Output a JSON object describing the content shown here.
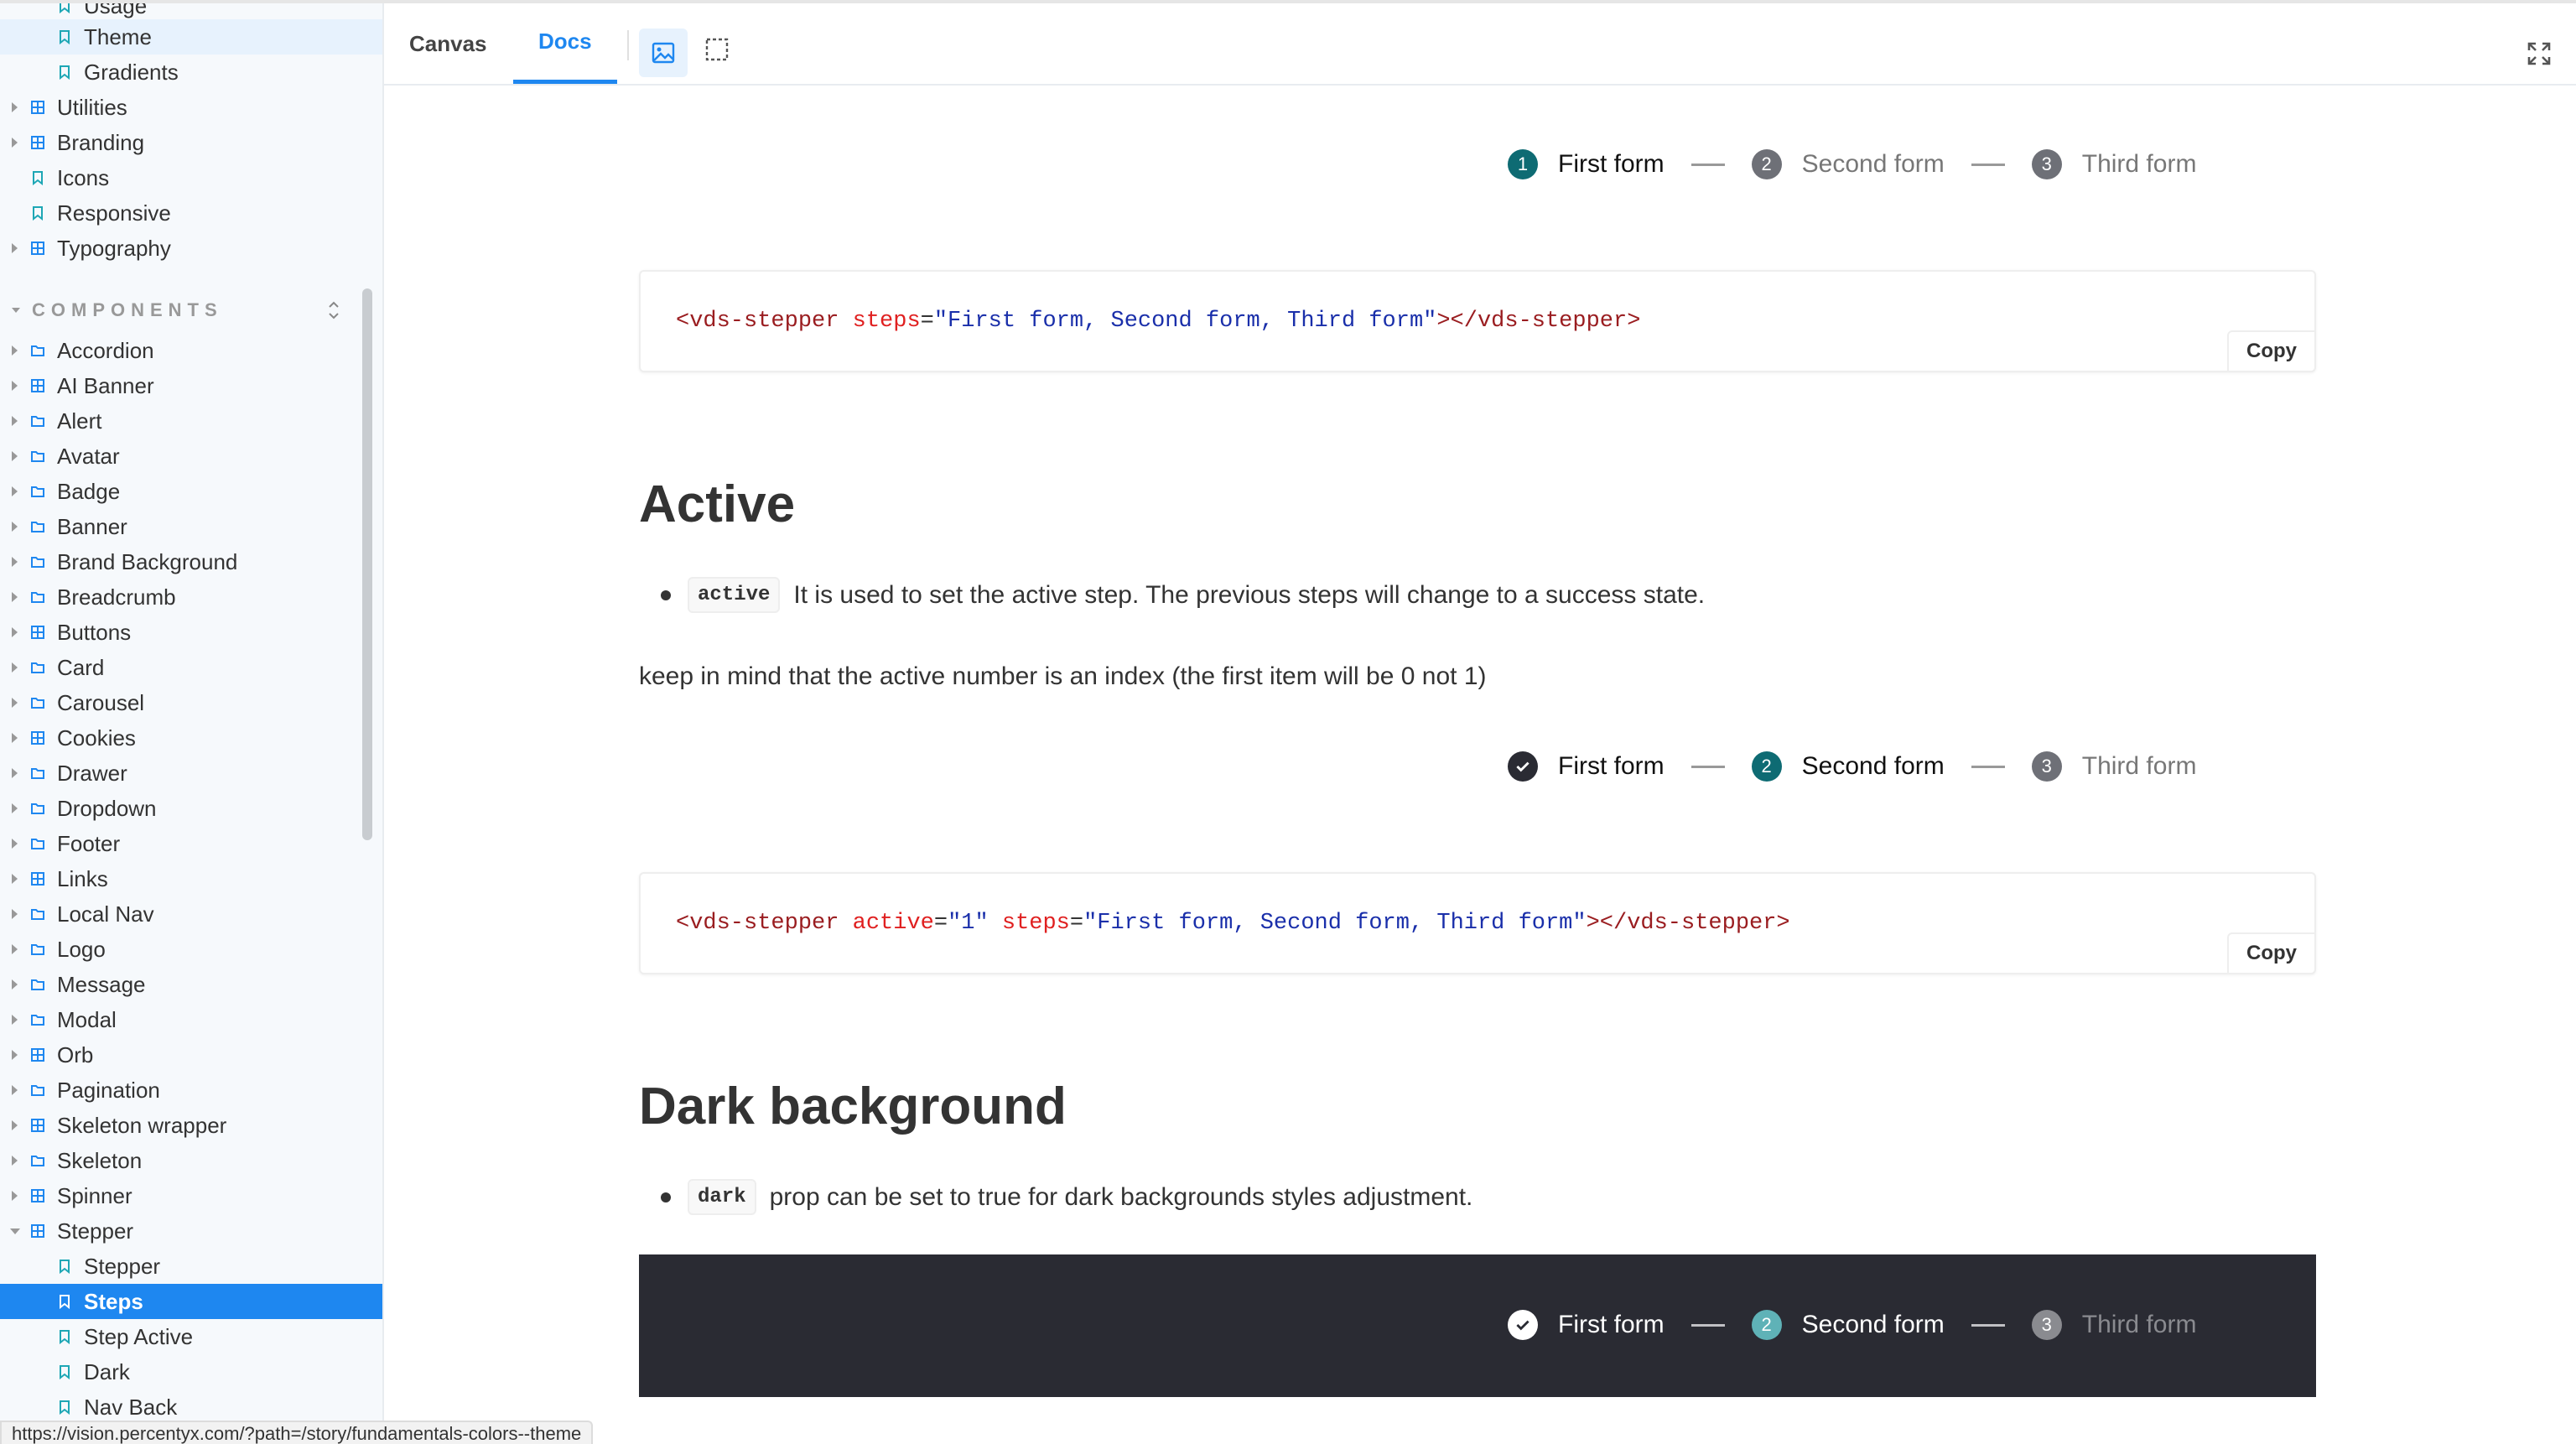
{
  "sidebar": {
    "items_top": [
      {
        "label": "Usage",
        "type": "story",
        "level": 1
      },
      {
        "label": "Theme",
        "type": "story",
        "level": 1,
        "state": "hover"
      },
      {
        "label": "Gradients",
        "type": "story",
        "level": 1
      },
      {
        "label": "Utilities",
        "type": "component",
        "level": 0
      },
      {
        "label": "Branding",
        "type": "component",
        "level": 0
      },
      {
        "label": "Icons",
        "type": "story",
        "level": 0
      },
      {
        "label": "Responsive",
        "type": "story",
        "level": 0
      },
      {
        "label": "Typography",
        "type": "component",
        "level": 0
      }
    ],
    "section_title": "COMPONENTS",
    "components": [
      {
        "label": "Accordion",
        "type": "folder"
      },
      {
        "label": "AI Banner",
        "type": "component"
      },
      {
        "label": "Alert",
        "type": "folder"
      },
      {
        "label": "Avatar",
        "type": "folder"
      },
      {
        "label": "Badge",
        "type": "folder"
      },
      {
        "label": "Banner",
        "type": "folder"
      },
      {
        "label": "Brand Background",
        "type": "folder"
      },
      {
        "label": "Breadcrumb",
        "type": "folder"
      },
      {
        "label": "Buttons",
        "type": "component"
      },
      {
        "label": "Card",
        "type": "folder"
      },
      {
        "label": "Carousel",
        "type": "folder"
      },
      {
        "label": "Cookies",
        "type": "component"
      },
      {
        "label": "Drawer",
        "type": "folder"
      },
      {
        "label": "Dropdown",
        "type": "folder"
      },
      {
        "label": "Footer",
        "type": "folder"
      },
      {
        "label": "Links",
        "type": "component"
      },
      {
        "label": "Local Nav",
        "type": "folder"
      },
      {
        "label": "Logo",
        "type": "folder"
      },
      {
        "label": "Message",
        "type": "folder"
      },
      {
        "label": "Modal",
        "type": "folder"
      },
      {
        "label": "Orb",
        "type": "component"
      },
      {
        "label": "Pagination",
        "type": "folder"
      },
      {
        "label": "Skeleton wrapper",
        "type": "component"
      },
      {
        "label": "Skeleton",
        "type": "folder"
      },
      {
        "label": "Spinner",
        "type": "component"
      },
      {
        "label": "Stepper",
        "type": "component",
        "expanded": true
      }
    ],
    "stepper_children": [
      {
        "label": "Stepper"
      },
      {
        "label": "Steps",
        "selected": true
      },
      {
        "label": "Step Active"
      },
      {
        "label": "Dark"
      },
      {
        "label": "Nav Back"
      }
    ]
  },
  "toolbar": {
    "tabs": [
      {
        "label": "Canvas",
        "active": false
      },
      {
        "label": "Docs",
        "active": true
      }
    ],
    "tools": [
      "image-icon",
      "outline-icon"
    ],
    "fullscreen": "fullscreen-icon"
  },
  "doc": {
    "stepper1": {
      "steps": [
        {
          "num": "1",
          "label": "First form",
          "state": "current"
        },
        {
          "num": "2",
          "label": "Second form",
          "state": "pending"
        },
        {
          "num": "3",
          "label": "Third form",
          "state": "pending"
        }
      ]
    },
    "code1": {
      "tag_open": "<vds-stepper",
      "attr1": "steps",
      "eq1": "=",
      "val1": "\"First form, Second form, Third form\"",
      "close": "></vds-stepper>",
      "copy": "Copy"
    },
    "active_section": {
      "heading": "Active",
      "bullet_code": "active",
      "bullet_text": "It is used to set the active step. The previous steps will change to a success state.",
      "note": "keep in mind that the active number is an index (the first item will be 0 not 1)"
    },
    "stepper2": {
      "steps": [
        {
          "num": "",
          "label": "First form",
          "state": "done"
        },
        {
          "num": "2",
          "label": "Second form",
          "state": "current"
        },
        {
          "num": "3",
          "label": "Third form",
          "state": "pending"
        }
      ]
    },
    "code2": {
      "tag_open": "<vds-stepper",
      "attr1": "active",
      "val1": "\"1\"",
      "attr2": "steps",
      "val2": "\"First form, Second form, Third form\"",
      "close": "></vds-stepper>",
      "copy": "Copy"
    },
    "dark_section": {
      "heading": "Dark background",
      "bullet_code": "dark",
      "bullet_text": "prop can be set to true for dark backgrounds styles adjustment."
    },
    "stepper3": {
      "steps": [
        {
          "num": "",
          "label": "First form",
          "state": "done"
        },
        {
          "num": "2",
          "label": "Second form",
          "state": "current"
        },
        {
          "num": "3",
          "label": "Third form",
          "state": "pending"
        }
      ]
    }
  },
  "status_bar": {
    "url": "https://vision.percentyx.com/?path=/story/fundamentals-colors--theme"
  },
  "colors": {
    "accent": "#1e87f0",
    "step_current": "#0e6b73",
    "dark_panel": "#2a2b33"
  }
}
